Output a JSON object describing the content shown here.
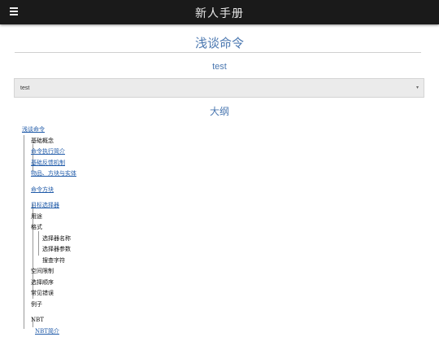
{
  "topbar": {
    "title": "新人手册",
    "menu_icon": "hamburger-menu-icon"
  },
  "page": {
    "title": "浅谈命令",
    "section_heading": "test"
  },
  "select": {
    "value": "test",
    "arrow": "▾"
  },
  "outline": {
    "title": "大纲",
    "root": "浅谈命令",
    "items": {
      "basic": "基础概念",
      "cmd_exec": "命令执行简介",
      "basic_feedback": "基础反馈机制",
      "entity": "物品、方块与实体",
      "cmd_block": "命令方块",
      "selector": "目标选择器",
      "usage": "用途",
      "format": "格式",
      "sel_name": "选择器名称",
      "sel_param": "选择器参数",
      "escape": "搜查字符",
      "space_limit": "空间限制",
      "sel_order": "选择顺序",
      "common_err": "常见错误",
      "example": "例子",
      "nbt": "NBT",
      "nbt_intro": "NBT简介"
    }
  }
}
